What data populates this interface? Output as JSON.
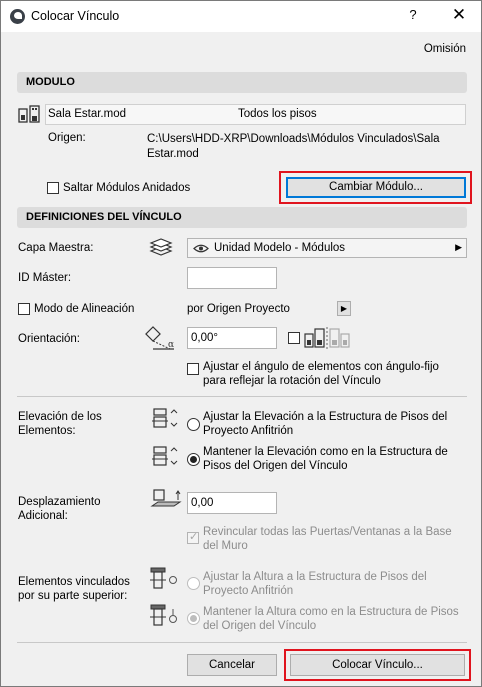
{
  "window": {
    "title": "Colocar Vínculo",
    "help": "?",
    "close": "✕"
  },
  "preset": "Omisión",
  "modulo": {
    "header": "MODULO",
    "file_name": "Sala Estar.mod",
    "floors": "Todos los pisos",
    "origin_label": "Origen:",
    "origin_path": "C:\\Users\\HDD-XRP\\Downloads\\Módulos Vinculados\\Sala Estar.mod",
    "skip_nested_label": "Saltar Módulos Anidados",
    "change_module_button": "Cambiar Módulo..."
  },
  "link": {
    "header": "DEFINICIONES DEL VÍNCULO",
    "master_layer_label": "Capa Maestra:",
    "master_layer_value": "Unidad Modelo - Módulos",
    "master_id_label": "ID Máster:",
    "master_id_value": "",
    "alignment_label": "Modo de Alineación",
    "alignment_value": "por Origen Proyecto",
    "orientation_label": "Orientación:",
    "orientation_value": "0,00°",
    "adjust_angle_label": "Ajustar el ángulo de elementos con ángulo-fijo para reflejar la rotación del Vínculo",
    "elevation_label": "Elevación de los Elementos:",
    "elevation_opt1": "Ajustar la Elevación a la Estructura de Pisos del Proyecto Anfitrión",
    "elevation_opt2": "Mantener la Elevación como en la Estructura de Pisos del Origen del Vínculo",
    "offset_label": "Desplazamiento Adicional:",
    "offset_value": "0,00",
    "relink_label": "Revincular todas las Puertas/Ventanas a la Base del Muro",
    "top_linked_label": "Elementos vinculados por su parte superior:",
    "top_opt1": "Ajustar la Altura a la Estructura de Pisos del Proyecto Anfitrión",
    "top_opt2": "Mantener la Altura como en la Estructura de Pisos del Origen del Vínculo"
  },
  "footer": {
    "cancel": "Cancelar",
    "place": "Colocar Vínculo..."
  },
  "colors": {
    "highlight": "#e0141e",
    "accent": "#0078d7"
  }
}
